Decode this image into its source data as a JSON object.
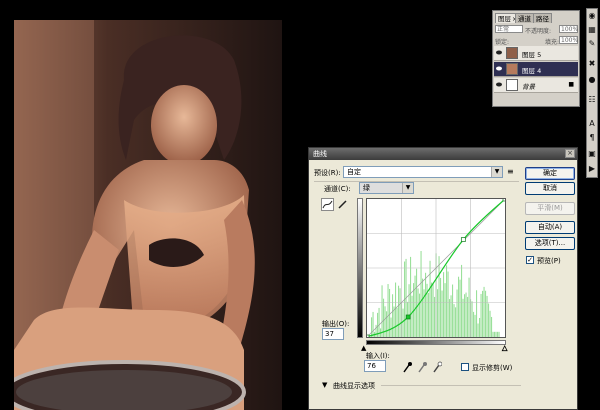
{
  "layers_panel": {
    "tabs": [
      "图层",
      "通道",
      "路径"
    ],
    "blend_mode": "正常",
    "opacity_label": "不透明度:",
    "opacity_value": "100%",
    "lock_label": "锁定:",
    "fill_label": "填充:",
    "fill_value": "100%",
    "layers": [
      {
        "name": "图层 5",
        "selected": false
      },
      {
        "name": "图层 4",
        "selected": true
      },
      {
        "name": "背景",
        "selected": false
      }
    ]
  },
  "curves_dialog": {
    "title": "曲线",
    "preset_label": "预设(R):",
    "preset_value": "自定",
    "channel_label": "通道(C):",
    "channel_value": "绿",
    "output_label": "输出(O):",
    "output_value": "37",
    "input_label": "输入(I):",
    "input_value": "76",
    "show_clipping_label": "显示修剪(W)",
    "options_toggle_label": "曲线显示选项",
    "buttons": {
      "ok": "确定",
      "cancel": "取消",
      "smooth": "平滑(M)",
      "auto": "自动(A)",
      "options": "选项(T)..."
    },
    "preview_label": "预览(P)",
    "preview_checked": true,
    "curve_points": [
      [
        0,
        0
      ],
      [
        76,
        37
      ],
      [
        178,
        180
      ],
      [
        255,
        255
      ]
    ],
    "colors": {
      "curve": "#18c82a",
      "histogram": "#9be09b"
    }
  }
}
